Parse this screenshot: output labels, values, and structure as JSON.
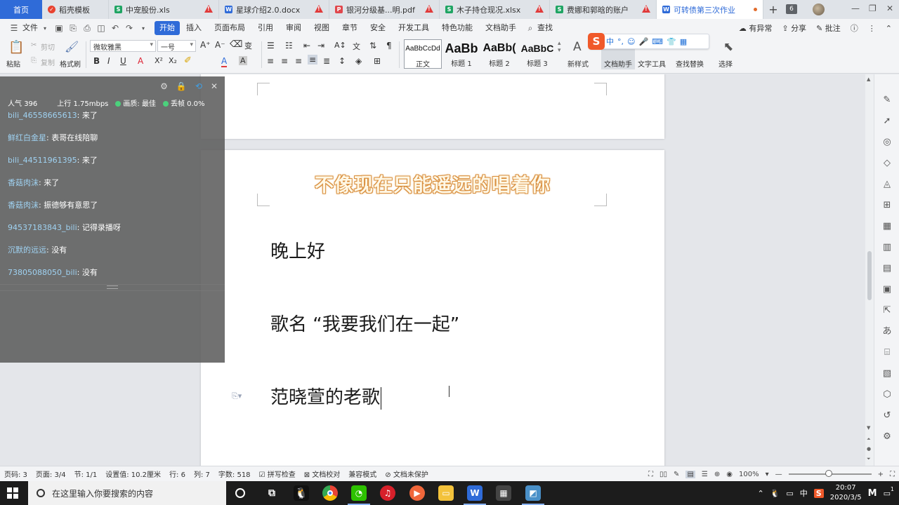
{
  "tabs": [
    {
      "label": "首页",
      "kind": "home"
    },
    {
      "label": "稻壳模板",
      "icon": "docer-icon",
      "color": "#e8422f"
    },
    {
      "label": "中宠股份.xls",
      "icon": "spreadsheet-icon",
      "color": "#1fa463",
      "warning": true
    },
    {
      "label": "星球介绍2.0.docx",
      "icon": "writer-icon",
      "color": "#2f6bd8",
      "warning": true
    },
    {
      "label": "银河分级基...明.pdf",
      "icon": "pdf-icon",
      "color": "#e0474c",
      "warning": true
    },
    {
      "label": "木子持仓现况.xlsx",
      "icon": "spreadsheet-icon",
      "color": "#1fa463",
      "warning": true
    },
    {
      "label": "费娜和郭晗的账户",
      "icon": "spreadsheet-icon",
      "color": "#1fa463",
      "warning": true
    },
    {
      "label": "可转债第三次作业",
      "icon": "writer-icon",
      "color": "#2f6bd8",
      "active": true
    }
  ],
  "tab_count": "6",
  "menu": {
    "file": "文件",
    "items": [
      "开始",
      "插入",
      "页面布局",
      "引用",
      "审阅",
      "视图",
      "章节",
      "安全",
      "开发工具",
      "特色功能",
      "文档助手"
    ],
    "search": "查找",
    "right": [
      "有异常",
      "分享",
      "批注"
    ]
  },
  "ribbon": {
    "paste": "粘贴",
    "cut": "剪切",
    "copy": "复制",
    "format_painter": "格式刷",
    "font_name": "微软雅黑",
    "font_size": "一号",
    "styles": [
      {
        "sample": "AaBbCcDd",
        "label": "正文"
      },
      {
        "sample": "AaBb",
        "label": "标题 1"
      },
      {
        "sample": "AaBb(",
        "label": "标题 2"
      },
      {
        "sample": "AaBbC",
        "label": "标题 3"
      }
    ],
    "new_style": "新样式",
    "doc_helper": "文档助手",
    "text_tools": "文字工具",
    "find_replace": "查找替换",
    "select": "选择"
  },
  "ime": {
    "mode": "中"
  },
  "chat": {
    "popularity_label": "人气",
    "popularity": "396",
    "upload_label": "上行",
    "upload": "1.75mbps",
    "quality_label": "画质:",
    "quality": "最佳",
    "loss_label": "丢帧",
    "loss": "0.0%",
    "messages": [
      {
        "user": "bili_46558665613",
        "text": "来了"
      },
      {
        "user": "鲜红白金星",
        "text": "表哥在线陪聊"
      },
      {
        "user": "bili_44511961395",
        "text": "来了"
      },
      {
        "user": "香菇肉沫",
        "text": "来了"
      },
      {
        "user": "香菇肉沫",
        "text": "振德够有意思了"
      },
      {
        "user": "94537183843_bili",
        "text": "记得录播呀"
      },
      {
        "user": "沉默的远远",
        "text": "没有"
      },
      {
        "user": "73805088050_bili",
        "text": "没有"
      }
    ]
  },
  "document": {
    "subtitle": "不像现在只能遥远的唱着你",
    "lines": [
      "晚上好",
      "歌名 “我要我们在一起”",
      "范晓萱的老歌"
    ]
  },
  "status": {
    "page_code": "页码: 3",
    "pages": "页面: 3/4",
    "section": "节: 1/1",
    "setting": "设置值: 10.2厘米",
    "row": "行: 6",
    "col": "列: 7",
    "words": "字数: 518",
    "spell": "拼写检查",
    "proof": "文档校对",
    "compat": "兼容模式",
    "protect": "文档未保护",
    "zoom": "100%"
  },
  "taskbar": {
    "search_placeholder": "在这里输入你要搜索的内容",
    "time": "20:07",
    "date": "2020/3/5",
    "ime": "中",
    "notifications": "1"
  }
}
